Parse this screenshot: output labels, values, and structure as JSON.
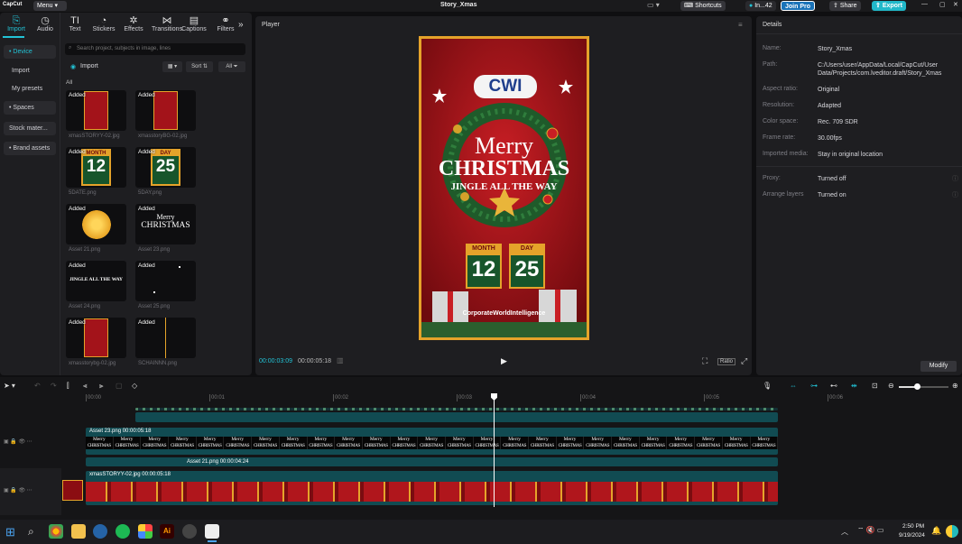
{
  "titlebar": {
    "app_name": "CapCut",
    "menu_label": "Menu",
    "project_name": "Story_Xmas",
    "shortcuts_label": "Shortcuts",
    "user_label": "In...42",
    "join_pro_label": "Join Pro",
    "share_label": "Share",
    "export_label": "Export"
  },
  "tools": [
    {
      "label": "Import",
      "icon": "import-icon",
      "glyph": "⎘"
    },
    {
      "label": "Audio",
      "icon": "audio-icon",
      "glyph": "◷"
    },
    {
      "label": "Text",
      "icon": "text-icon",
      "glyph": "TI"
    },
    {
      "label": "Stickers",
      "icon": "stickers-icon",
      "glyph": "◔"
    },
    {
      "label": "Effects",
      "icon": "effects-icon",
      "glyph": "✲"
    },
    {
      "label": "Transitions",
      "icon": "transitions-icon",
      "glyph": "⋈"
    },
    {
      "label": "Captions",
      "icon": "captions-icon",
      "glyph": "▤"
    },
    {
      "label": "Filters",
      "icon": "filters-icon",
      "glyph": "⚭"
    }
  ],
  "sidenav": {
    "device": "• Device",
    "import": "Import",
    "my_presets": "My presets",
    "spaces": "• Spaces",
    "stock": "Stock mater...",
    "brand": "• Brand assets"
  },
  "media_panel": {
    "search_placeholder": "Search project, subjects in image, lines",
    "import_label": "Import",
    "sort_label": "Sort",
    "all_filter_label": "All",
    "all_section_label": "All",
    "added_label": "Added",
    "items": [
      {
        "name": "xmasSTORYY-02.jpg",
        "thumb": "poster-red"
      },
      {
        "name": "xmasstoryBG-02.jpg",
        "thumb": "poster-red"
      },
      {
        "name": "5DATE.png",
        "thumb": "month12"
      },
      {
        "name": "5DAY.png",
        "thumb": "day25"
      },
      {
        "name": "Asset 21.png",
        "thumb": "bow"
      },
      {
        "name": "Asset 23.png",
        "thumb": "merry"
      },
      {
        "name": "Asset 24.png",
        "thumb": "jingle"
      },
      {
        "name": "Asset 25.png",
        "thumb": "sparkle"
      },
      {
        "name": "xmasstorybg-02.jpg",
        "thumb": "poster-red"
      },
      {
        "name": "SCHAINNN.png",
        "thumb": "chain"
      }
    ],
    "thumb_text": {
      "month": "MONTH",
      "month_num": "12",
      "day": "DAY",
      "day_num": "25",
      "merry": "Merry",
      "christmas": "CHRISTMAS",
      "jingle": "JINGLE ALL THE WAY"
    }
  },
  "player": {
    "title": "Player",
    "current_time": "00:00:03:09",
    "total_time": "00:00:05:18",
    "ratio_label": "Ratio",
    "poster": {
      "logo": "CWI",
      "merry": "Merry",
      "christmas": "CHRISTMAS",
      "jingle": "JINGLE ALL THE WAY",
      "month_label": "MONTH",
      "month_value": "12",
      "day_label": "DAY",
      "day_value": "25",
      "brand": "CorporateWorldIntelligence"
    }
  },
  "details": {
    "title": "Details",
    "rows": [
      {
        "key": "Name:",
        "value": "Story_Xmas"
      },
      {
        "key": "Path:",
        "value": "C:/Users/user/AppData/Local/CapCut/User Data/Projects/com.lveditor.draft/Story_Xmas"
      },
      {
        "key": "Aspect ratio:",
        "value": "Original"
      },
      {
        "key": "Resolution:",
        "value": "Adapted"
      },
      {
        "key": "Color space:",
        "value": "Rec. 709 SDR"
      },
      {
        "key": "Frame rate:",
        "value": "30.00fps"
      },
      {
        "key": "Imported media:",
        "value": "Stay in original location"
      },
      {
        "key": "Proxy:",
        "value": "Turned off"
      },
      {
        "key": "Arrange layers",
        "value": "Turned on"
      }
    ],
    "modify_label": "Modify"
  },
  "timeline": {
    "ruler": [
      "00:00",
      "00:01",
      "00:02",
      "00:03",
      "00:04",
      "00:05",
      "00:06"
    ],
    "clip_asset23": {
      "name": "Asset 23.png",
      "duration": "00:00:05:18"
    },
    "clip_asset21": {
      "name": "Asset 21.png",
      "duration": "00:00:04:24"
    },
    "clip_main": {
      "name": "xmasSTORYY-02.jpg",
      "duration": "00:00:05:18"
    },
    "merry_text": "Merry",
    "christmas_text": "CHRISTMAS"
  },
  "taskbar": {
    "time": "2:50 PM",
    "date": "9/19/2024"
  },
  "colors": {
    "accent": "#22c3d6",
    "poster_red": "#8b0d12",
    "gold": "#e5a32a",
    "clip_teal": "#114b52"
  }
}
